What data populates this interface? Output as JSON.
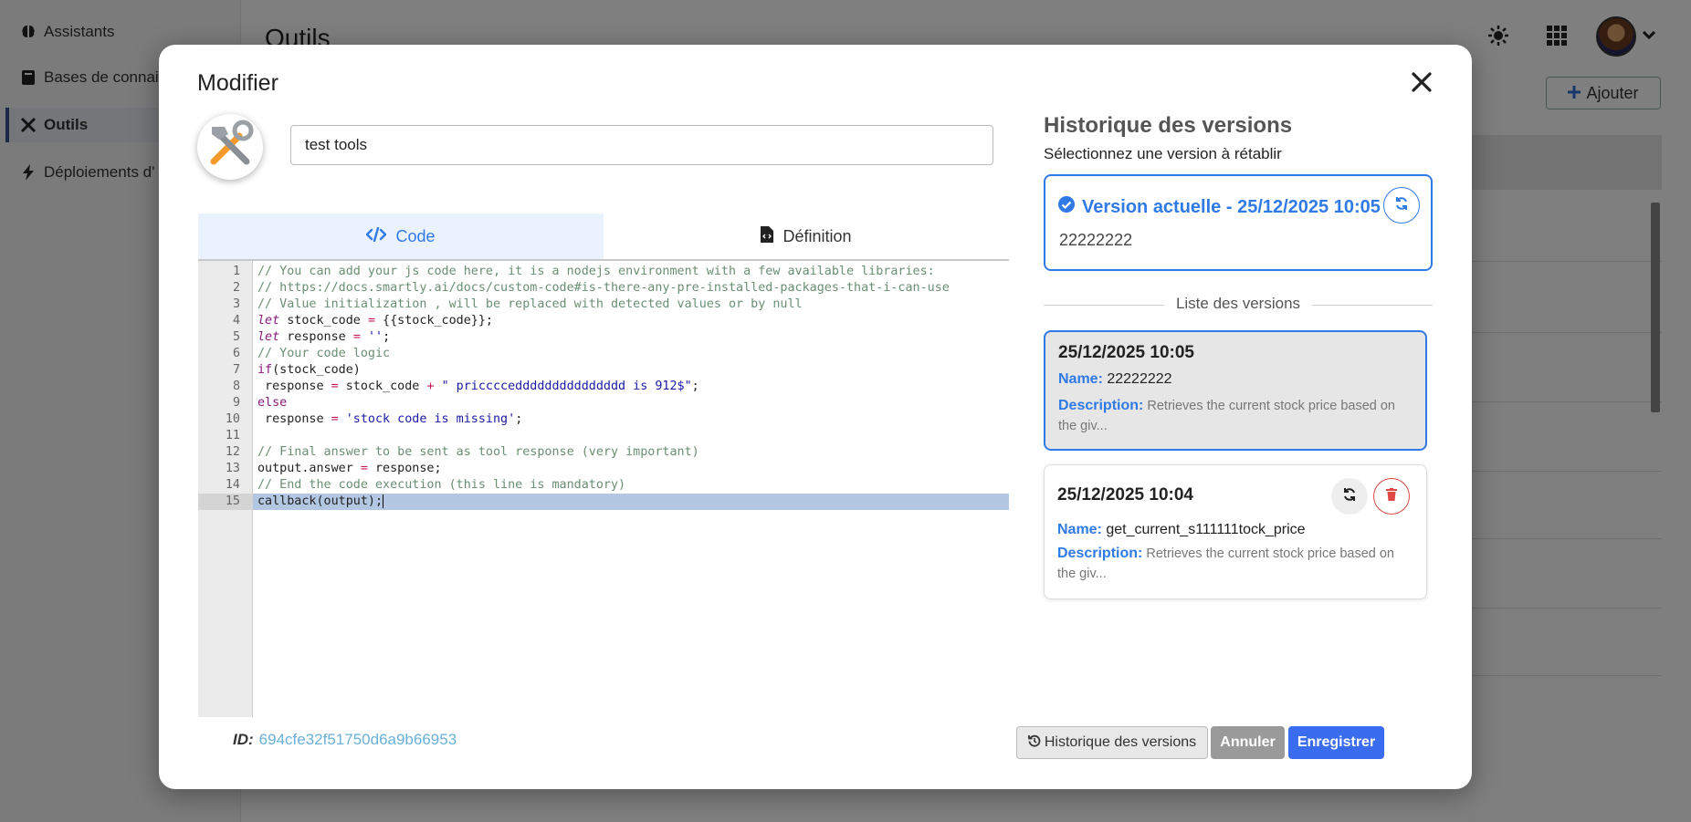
{
  "background": {
    "sidebar": {
      "items": [
        {
          "label": "Assistants",
          "icon": "brain-icon"
        },
        {
          "label": "Bases de connais",
          "icon": "book-icon"
        },
        {
          "label": "Outils",
          "icon": "tools-icon"
        },
        {
          "label": "Déploiements d'",
          "icon": "bolt-icon"
        }
      ],
      "active_index": 2
    },
    "page_title": "Outils",
    "add_button": "Ajouter"
  },
  "modal": {
    "title": "Modifier",
    "tool_name": "test tools",
    "tabs": [
      {
        "label": "Code",
        "icon": "code-icon",
        "active": true
      },
      {
        "label": "Définition",
        "icon": "file-code-icon",
        "active": false
      }
    ],
    "code_lines": [
      "// You can add your js code here, it is a nodejs environment with a few available libraries:",
      "// https://docs.smartly.ai/docs/custom-code#is-there-any-pre-installed-packages-that-i-can-use",
      "// Value initialization , will be replaced with detected values or by null",
      "let stock_code = {{stock_code}};",
      "let response = '';",
      "// Your code logic",
      "if(stock_code)",
      " response = stock_code + \" pricccceddddddddddddddd is 912$\";",
      "else",
      " response = 'stock code is missing';",
      "",
      "// Final answer to be sent as tool response (very important)",
      "output.answer = response;",
      "// End the code execution (this line is mandatory)",
      "callback(output);"
    ],
    "highlighted_line": 15,
    "id_label": "ID:",
    "id_value": "694cfe32f51750d6a9b66953",
    "history": {
      "title": "Historique des versions",
      "subtitle": "Sélectionnez une version à rétablir",
      "current": {
        "title": "Version actuelle - 25/12/2025 10:05",
        "value": "22222222"
      },
      "list_label": "Liste des versions",
      "versions": [
        {
          "date": "25/12/2025 10:05",
          "name_label": "Name:",
          "name": "22222222",
          "desc_label": "Description:",
          "description": "Retrieves the current stock price based on the giv...",
          "selected": true
        },
        {
          "date": "25/12/2025 10:04",
          "name_label": "Name:",
          "name": "get_current_s111111tock_price",
          "desc_label": "Description:",
          "description": "Retrieves the current stock price based on the giv...",
          "selected": false
        }
      ]
    },
    "buttons": {
      "history": "Historique des versions",
      "cancel": "Annuler",
      "save": "Enregistrer"
    }
  },
  "colors": {
    "accent": "#2f7ae5",
    "save": "#3a6cf0",
    "cancel": "#9a9a9a",
    "delete": "#e04848"
  }
}
